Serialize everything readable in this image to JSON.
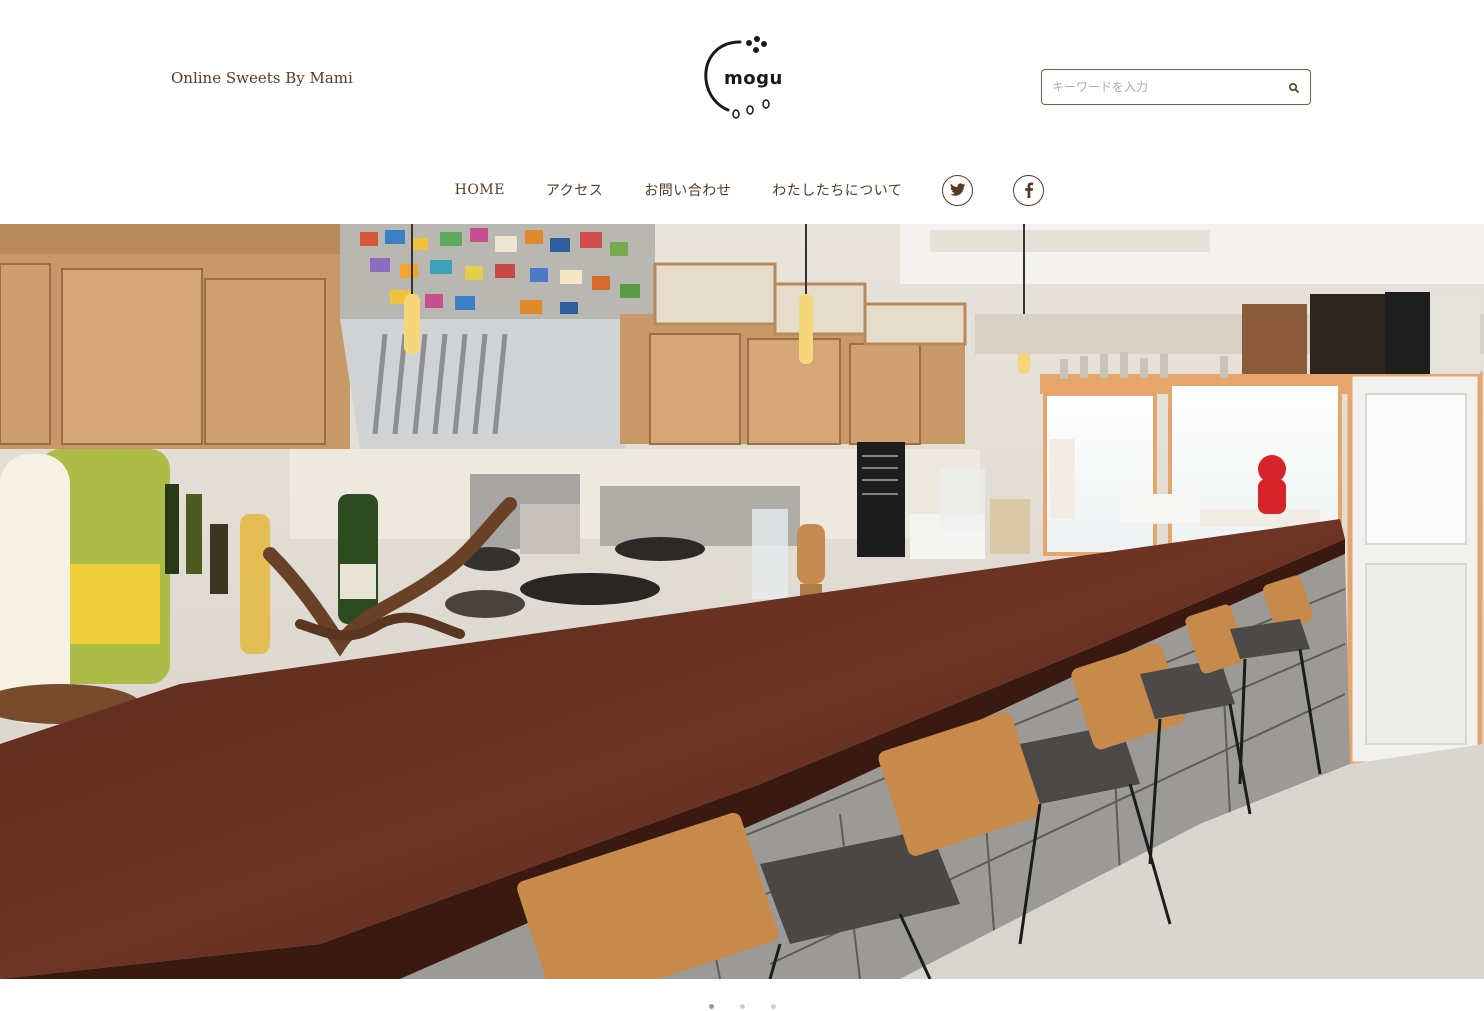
{
  "header": {
    "tagline": "Online Sweets By Mami",
    "logo_text": "mogu"
  },
  "search": {
    "placeholder": "キーワードを入力",
    "icon": "search-icon"
  },
  "nav": {
    "items": [
      {
        "label": "HOME"
      },
      {
        "label": "アクセス"
      },
      {
        "label": "お問い合わせ"
      },
      {
        "label": "わたしたちについて"
      }
    ],
    "social": [
      {
        "icon": "twitter-icon"
      },
      {
        "icon": "facebook-icon"
      }
    ]
  },
  "slider": {
    "slide_count": 3,
    "active_index": 0
  },
  "colors": {
    "text": "#5a3a22",
    "border": "#7a5a40",
    "background": "#ffffff"
  }
}
